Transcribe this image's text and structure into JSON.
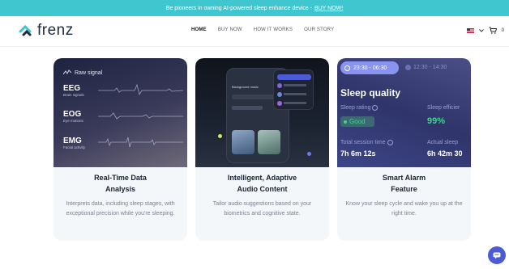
{
  "banner": {
    "text": "Be pioneers in owning AI-powered sleep enhance device -",
    "link": "BUY NOW!"
  },
  "brand": {
    "name": "frenz"
  },
  "nav": {
    "items": [
      "HOME",
      "BUY NOW",
      "HOW IT WORKS",
      "OUR STORY"
    ],
    "active": "HOME",
    "cart_count": "0"
  },
  "card1": {
    "signal_label": "Raw signal",
    "rows": [
      {
        "name": "EEG",
        "sub": "Brain signals"
      },
      {
        "name": "EOG",
        "sub": "Eye motions"
      },
      {
        "name": "EMG",
        "sub": "Facial activity"
      }
    ],
    "title_line1": "Real-Time Data",
    "title_line2": "Analysis",
    "desc": "Interprets data, including sleep stages, with exceptional precision while you're sleeping."
  },
  "card2": {
    "phone_heading": "Background music",
    "title_line1": "Intelligent, Adaptive",
    "title_line2": "Audio Content",
    "desc": "Tailor audio suggestions based on your biometrics and cognitive state."
  },
  "card3": {
    "time_active": "23:30 - 06:30",
    "time_other": "12:30 - 14:30",
    "heading": "Sleep quality",
    "rating_label": "Sleep rating",
    "rating_value": "Good",
    "efficiency_label": "Sleep efficier",
    "efficiency_value": "99%",
    "session_label": "Total session time",
    "session_value": "7h 6m 12s",
    "actual_label": "Actual sleep",
    "actual_value": "6h 42m 30",
    "title_line1": "Smart Alarm",
    "title_line2": "Feature",
    "desc": "Know your sleep cycle and wake you up at the right time."
  },
  "colors": {
    "banner": "#3fc6cf",
    "brand": "#1f2a44",
    "good": "#3dd68c",
    "chat": "#4c5ad6"
  }
}
